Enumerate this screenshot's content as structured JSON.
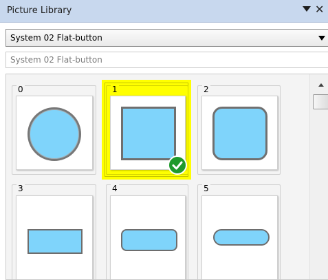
{
  "panel": {
    "title": "Picture Library"
  },
  "library_select": {
    "value": "System 02 Flat-button"
  },
  "name_field": {
    "value": "System 02 Flat-button"
  },
  "gallery": {
    "items": [
      {
        "label": "0",
        "shape": "circle",
        "selected": false
      },
      {
        "label": "1",
        "shape": "square",
        "selected": true
      },
      {
        "label": "2",
        "shape": "rounded-square",
        "selected": false
      },
      {
        "label": "3",
        "shape": "rectangle",
        "selected": false
      },
      {
        "label": "4",
        "shape": "rounded-rectangle",
        "selected": false
      },
      {
        "label": "5",
        "shape": "pill",
        "selected": false
      }
    ]
  },
  "colors": {
    "header_bg": "#c8d8ee",
    "shape_fill": "#7fd4fb",
    "selection": "#ffff00",
    "check_badge": "#1f9a2c"
  },
  "icons": {
    "pin": "dropdown-arrow-icon",
    "close": "close-icon",
    "check": "checkmark-icon"
  }
}
